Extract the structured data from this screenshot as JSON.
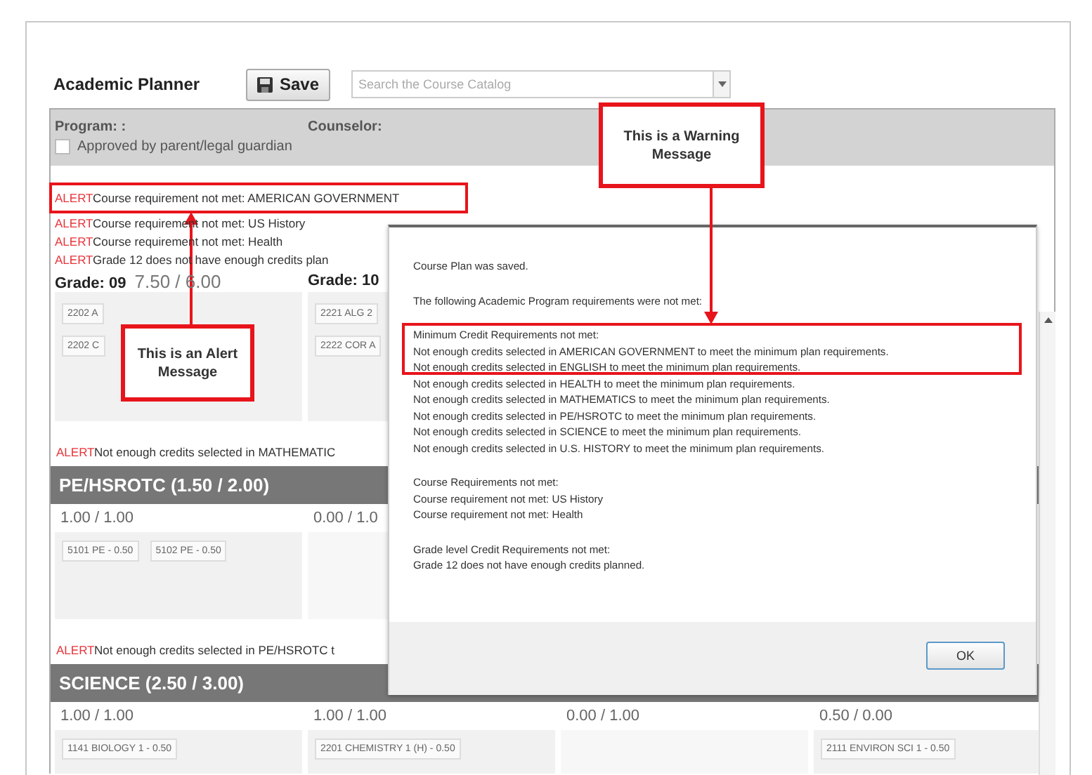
{
  "header": {
    "title": "Academic Planner",
    "save_button": "Save",
    "search": {
      "placeholder": "Search the Course Catalog"
    }
  },
  "program_panel": {
    "program_label": "Program: :",
    "counselor_label": "Counselor:",
    "approval": {
      "label": "Approved by parent/legal guardian",
      "checked": false
    }
  },
  "alerts": [
    {
      "tag": "ALERT",
      "text": "Course requirement not met: AMERICAN GOVERNMENT"
    },
    {
      "tag": "ALERT",
      "text": "Course requirement not met: US History"
    },
    {
      "tag": "ALERT",
      "text": "Course requirement not met: Health"
    },
    {
      "tag": "ALERT",
      "text": "Grade 12 does not have enough credits plan"
    }
  ],
  "grades": [
    {
      "label": "Grade: 09",
      "credits": "7.50 / 6.00",
      "courses": [
        "2202 A",
        "2202 C"
      ]
    },
    {
      "label": "Grade: 10",
      "courses": [
        "2221 ALG 2",
        "2222 COR A"
      ]
    }
  ],
  "mathematics_alert": {
    "tag": "ALERT",
    "text": "Not enough credits selected in MATHEMATIC"
  },
  "sections": [
    {
      "title": "PE/HSROTC (1.50 / 2.00)",
      "columns": [
        {
          "credits": "1.00 / 1.00",
          "courses": [
            "5101 PE - 0.50",
            "5102 PE - 0.50"
          ]
        },
        {
          "credits": "0.00 / 1.0"
        }
      ],
      "alert": {
        "tag": "ALERT",
        "text": "Not enough credits selected in PE/HSROTC t"
      }
    },
    {
      "title": "SCIENCE (2.50 / 3.00)",
      "columns": [
        {
          "credits": "1.00 / 1.00",
          "courses": [
            "1141 BIOLOGY 1 - 0.50"
          ]
        },
        {
          "credits": "1.00 / 1.00",
          "courses": [
            "2201 CHEMISTRY 1 (H) - 0.50"
          ]
        },
        {
          "credits": "0.00 / 1.00"
        },
        {
          "credits": "0.50 / 0.00",
          "courses": [
            "2111 ENVIRON SCI 1 - 0.50"
          ]
        }
      ]
    }
  ],
  "dialog": {
    "paragraphs": [
      [
        "Course Plan was saved."
      ],
      [
        "The following Academic Program requirements were not met:"
      ],
      [
        "Minimum Credit Requirements not met:",
        "Not enough credits selected in AMERICAN GOVERNMENT to meet the minimum plan requirements.",
        "Not enough credits selected in ENGLISH to meet the minimum plan requirements.",
        "Not enough credits selected in HEALTH to meet the minimum plan requirements.",
        "Not enough credits selected in MATHEMATICS to meet the minimum plan requirements.",
        "Not enough credits selected in PE/HSROTC to meet the minimum plan requirements.",
        "Not enough credits selected in SCIENCE to meet the minimum plan requirements.",
        "Not enough credits selected in U.S. HISTORY to meet the minimum plan requirements."
      ],
      [
        "Course Requirements not met:",
        "Course requirement not met: US History",
        "Course requirement not met: Health"
      ],
      [
        "Grade level Credit Requirements not met:",
        "Grade 12 does not have enough credits planned."
      ]
    ],
    "ok_button": "OK"
  },
  "callouts": [
    {
      "text": "This is an Alert Message",
      "kind": "alert"
    },
    {
      "text": "This is a Warning Message",
      "kind": "warning"
    }
  ]
}
